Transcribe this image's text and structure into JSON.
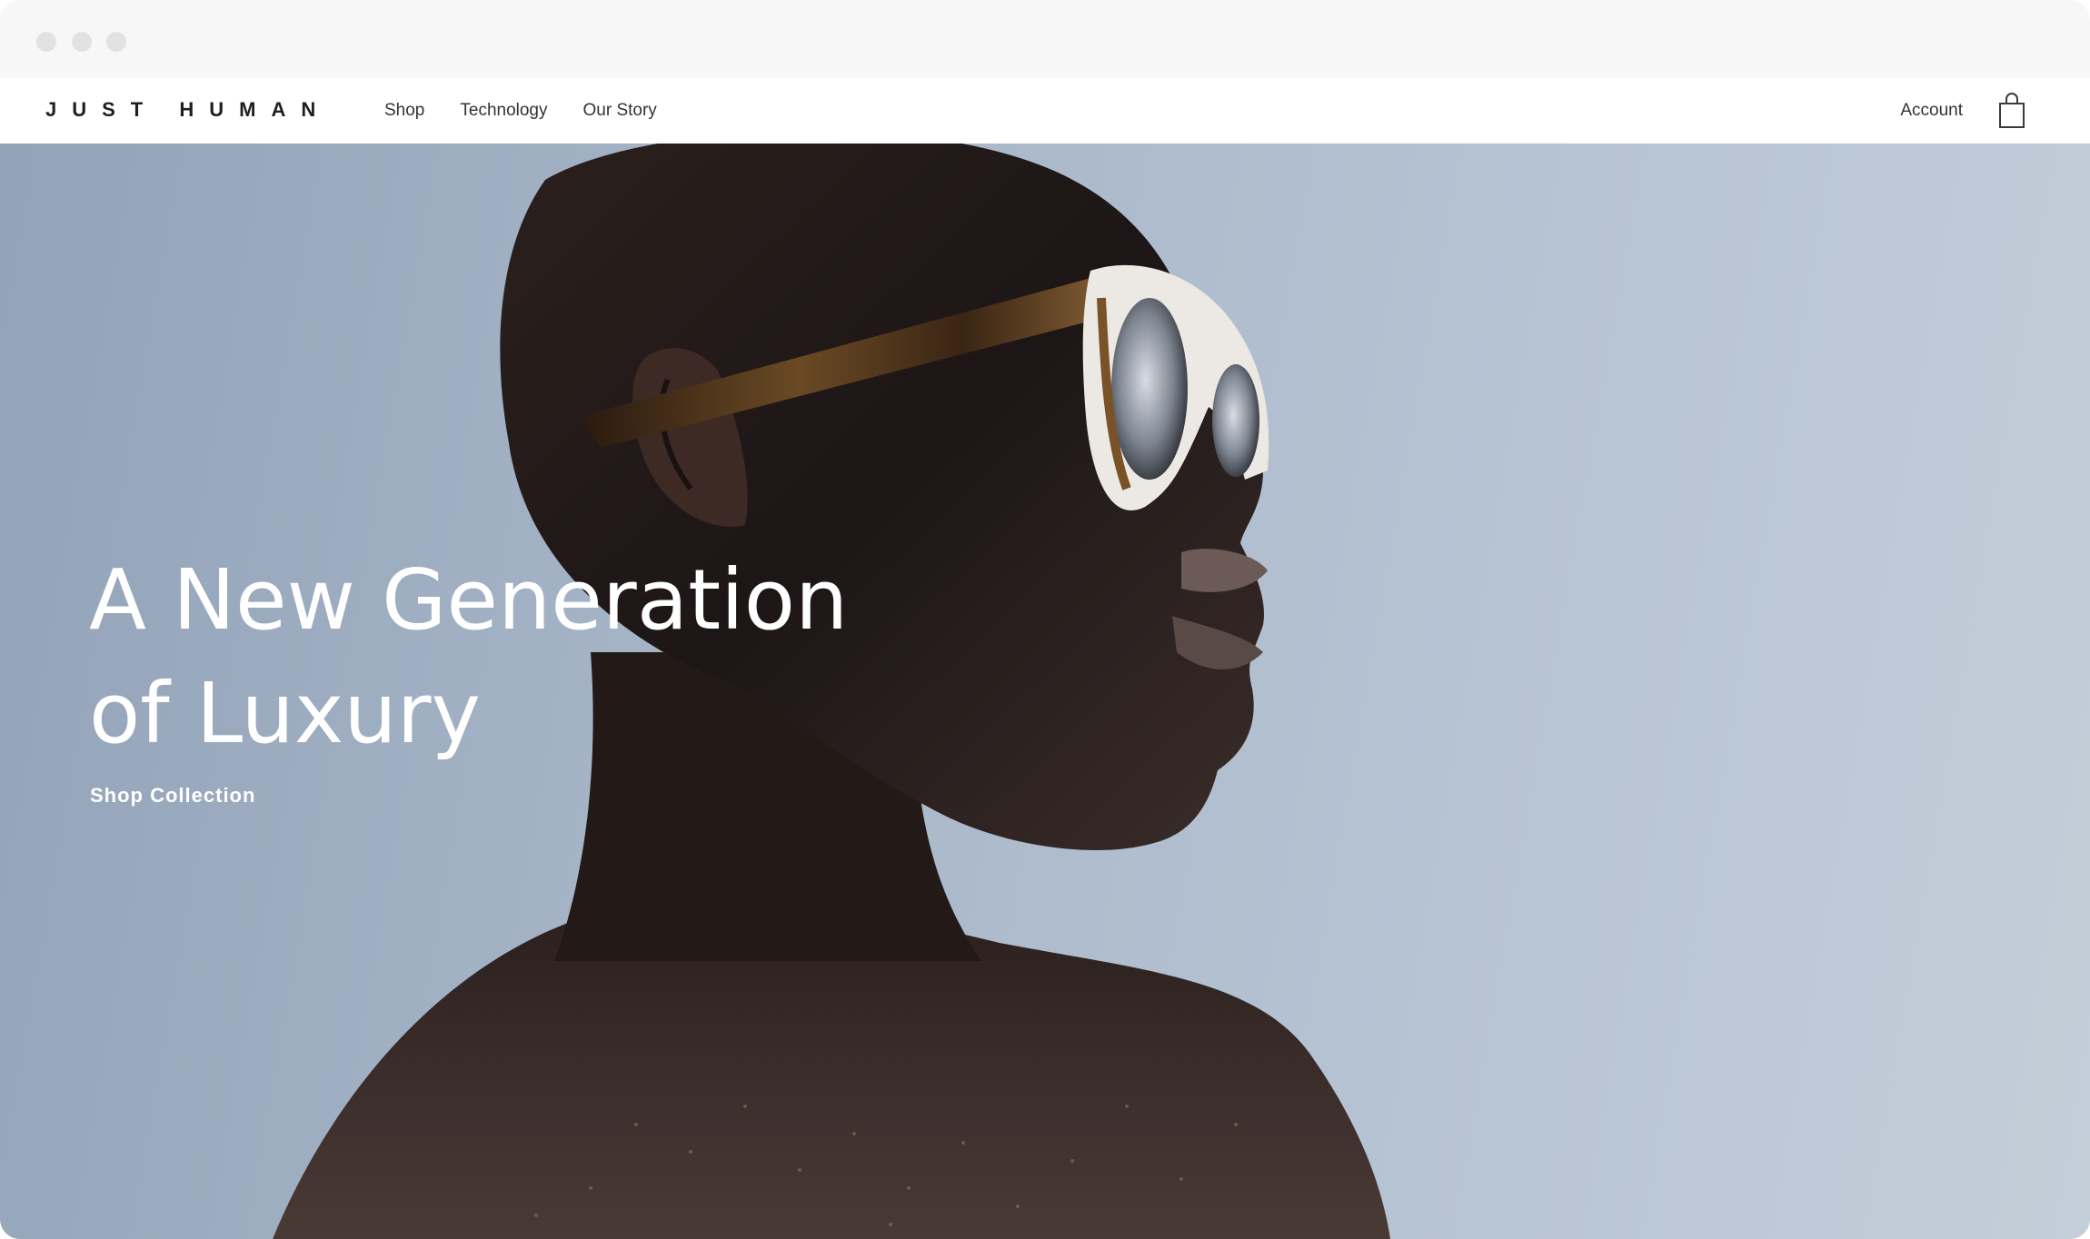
{
  "browser": {
    "window_controls": [
      "close",
      "minimize",
      "zoom"
    ]
  },
  "nav": {
    "logo": "JUST HUMAN",
    "links": [
      {
        "label": "Shop"
      },
      {
        "label": "Technology"
      },
      {
        "label": "Our Story"
      }
    ],
    "account_label": "Account",
    "cart_icon": "shopping-bag-icon"
  },
  "hero": {
    "title_line1": "A New Generation",
    "title_line2": "of Luxury",
    "cta_label": "Shop Collection",
    "image_subject": "person wearing tortoiseshell sunglasses against sky"
  },
  "colors": {
    "sky": "#b7c4d4",
    "text_on_hero": "#ffffff",
    "nav_text": "#333333",
    "chrome_bg": "#f7f7f7"
  }
}
